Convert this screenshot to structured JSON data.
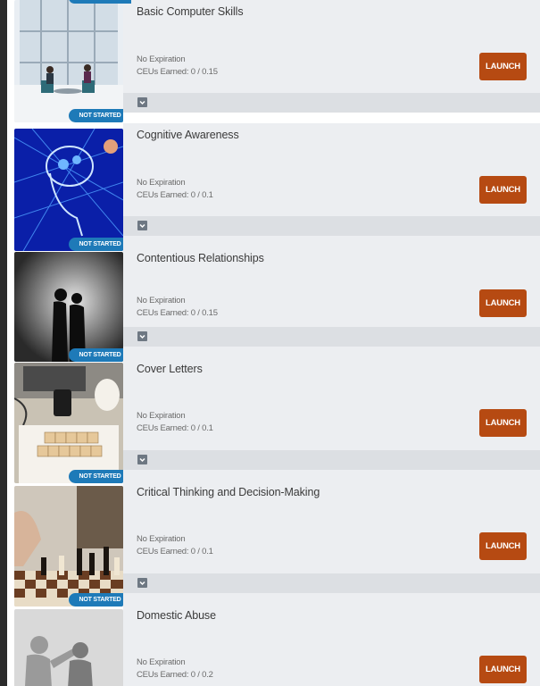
{
  "status_label": "NOT STARTED",
  "launch_label": "LAUNCH",
  "courses": [
    {
      "title": "Basic Computer Skills",
      "expiration": "No Expiration",
      "ceus": "CEUs Earned: 0 / 0.15",
      "image": "office-meeting"
    },
    {
      "title": "Cognitive Awareness",
      "expiration": "No Expiration",
      "ceus": "CEUs Earned: 0 / 0.1",
      "image": "blue-brain"
    },
    {
      "title": "Contentious Relationships",
      "expiration": "No Expiration",
      "ceus": "CEUs Earned: 0 / 0.15",
      "image": "silhouettes-back-to-back"
    },
    {
      "title": "Cover Letters",
      "expiration": "No Expiration",
      "ceus": "CEUs Earned: 0 / 0.1",
      "image": "cover-letter-blocks"
    },
    {
      "title": "Critical Thinking and Decision-Making",
      "expiration": "No Expiration",
      "ceus": "CEUs Earned: 0 / 0.1",
      "image": "chess-board"
    },
    {
      "title": "Domestic Abuse",
      "expiration": "No Expiration",
      "ceus": "CEUs Earned: 0 / 0.2",
      "image": "shadow-silhouettes"
    }
  ],
  "colors": {
    "badge": "#1e7ab8",
    "launch": "#b64a12",
    "panel": "#eceef1",
    "expand_bar": "#dcdfe3"
  }
}
